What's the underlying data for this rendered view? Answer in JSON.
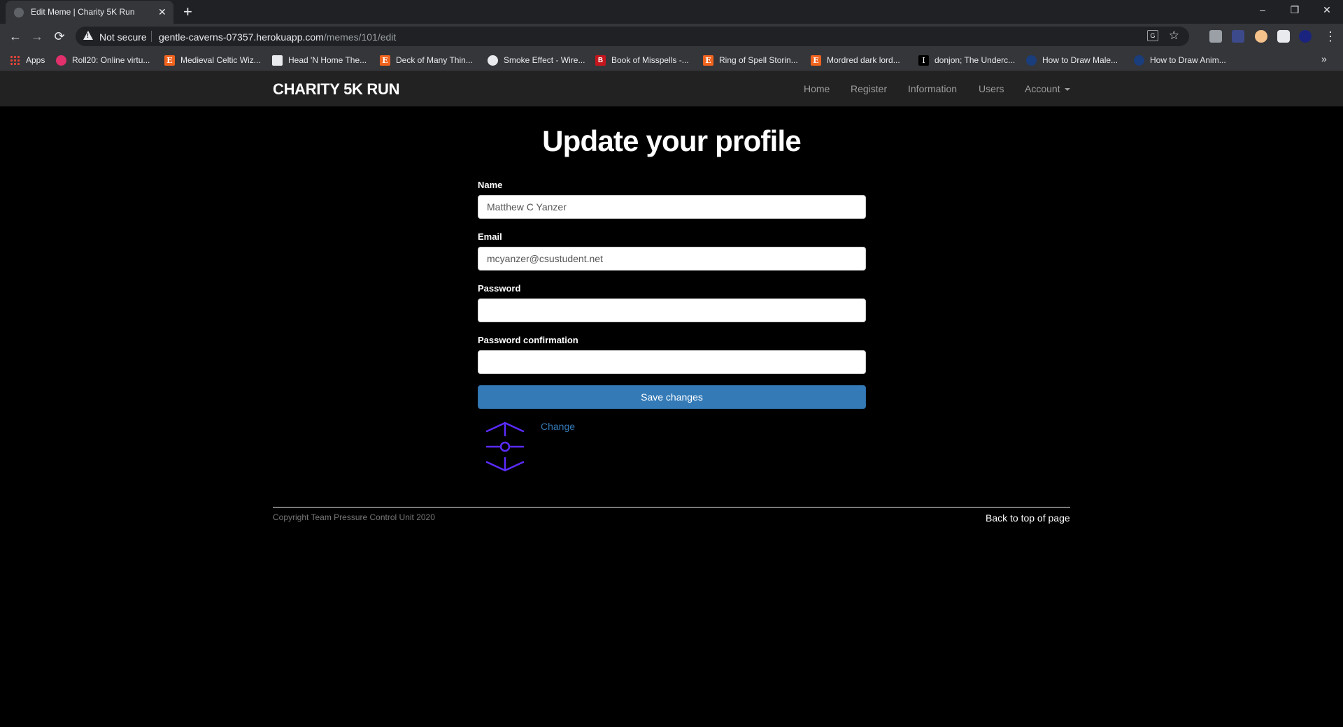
{
  "browser": {
    "tab_title": "Edit Meme | Charity 5K Run",
    "tab_close": "✕",
    "new_tab": "+",
    "window_controls": {
      "minimize": "–",
      "restore": "❐",
      "close": "✕"
    },
    "nav": {
      "back": "←",
      "forward": "→",
      "reload": "⟳"
    },
    "security_label": "Not secure",
    "url_host": "gentle-caverns-07357.herokuapp.com",
    "url_path": "/memes/101/edit",
    "translate_icon": "G",
    "star_icon": "☆",
    "menu_icon": "⋮",
    "bookmarks": [
      {
        "label": "Apps",
        "icon": "apps"
      },
      {
        "label": "Roll20: Online virtu...",
        "icon": "roll"
      },
      {
        "label": "Medieval Celtic Wiz...",
        "icon": "etsy",
        "glyph": "E"
      },
      {
        "label": "Head 'N Home The...",
        "icon": "head"
      },
      {
        "label": "Deck of Many Thin...",
        "icon": "etsy",
        "glyph": "E"
      },
      {
        "label": "Smoke Effect - Wire...",
        "icon": "smoke"
      },
      {
        "label": "Book of Misspells -...",
        "icon": "book",
        "glyph": "B"
      },
      {
        "label": "Ring of Spell Storin...",
        "icon": "etsy",
        "glyph": "E"
      },
      {
        "label": "Mordred dark lord...",
        "icon": "etsy",
        "glyph": "E"
      },
      {
        "label": "donjon; The Underc...",
        "icon": "don",
        "glyph": "I"
      },
      {
        "label": "How to Draw Male...",
        "icon": "draw"
      },
      {
        "label": "How to Draw Anim...",
        "icon": "draw"
      }
    ],
    "bookmarks_more": "»"
  },
  "site": {
    "brand": "CHARITY 5K RUN",
    "nav": {
      "home": "Home",
      "register": "Register",
      "information": "Information",
      "users": "Users",
      "account": "Account"
    }
  },
  "form": {
    "title": "Update your profile",
    "name_label": "Name",
    "name_value": "Matthew C Yanzer",
    "email_label": "Email",
    "email_value": "mcyanzer@csustudent.net",
    "password_label": "Password",
    "password_value": "",
    "confirmation_label": "Password confirmation",
    "confirmation_value": "",
    "submit_label": "Save changes",
    "change_link": "Change"
  },
  "footer": {
    "copyright": "Copyright Team Pressure Control Unit 2020",
    "back_to_top": "Back to top of page"
  },
  "colors": {
    "primary": "#337ab7",
    "navbar": "#222222",
    "background": "#000000",
    "gravatar": "#5b2bff"
  }
}
